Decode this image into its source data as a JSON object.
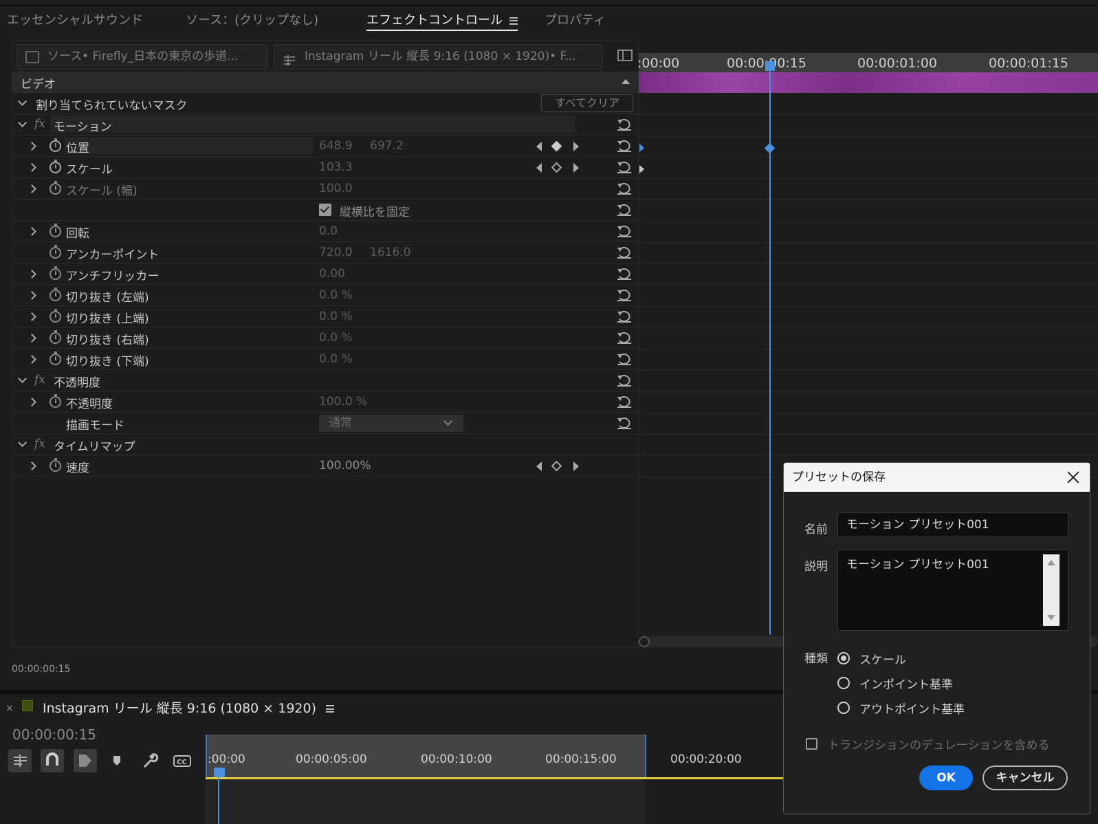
{
  "tabs": [
    {
      "label": "エッセンシャルサウンド",
      "active": false
    },
    {
      "label": "ソース：(クリップなし)",
      "active": false
    },
    {
      "label": "エフェクトコントロール",
      "active": true
    },
    {
      "label": "プロパティ",
      "active": false
    }
  ],
  "source_selector": {
    "source_label": "ソース• Firefly_日本の東京の歩道...",
    "sequence_label": "Instagram リール 縦長 9:16 (1080 × 1920)• F..."
  },
  "effect_controls": {
    "section_video": "ビデオ",
    "mask_label": "割り当てられていないマスク",
    "clear_all_button": "すべてクリア",
    "motion": {
      "title": "モーション",
      "position": {
        "label": "位置",
        "x": "648.9",
        "y": "697.2"
      },
      "scale": {
        "label": "スケール",
        "value": "103.3"
      },
      "scale_width": {
        "label": "スケール (幅)",
        "value": "100.0"
      },
      "uniform_scale": {
        "label": "縦横比を固定",
        "checked": true
      },
      "rotation": {
        "label": "回転",
        "value": "0.0"
      },
      "anchor": {
        "label": "アンカーポイント",
        "x": "720.0",
        "y": "1616.0"
      },
      "anti_flicker": {
        "label": "アンチフリッカー",
        "value": "0.00"
      },
      "crop_left": {
        "label": "切り抜き (左端)",
        "value": "0.0 %"
      },
      "crop_top": {
        "label": "切り抜き (上端)",
        "value": "0.0 %"
      },
      "crop_right": {
        "label": "切り抜き (右端)",
        "value": "0.0 %"
      },
      "crop_bottom": {
        "label": "切り抜き (下端)",
        "value": "0.0 %"
      }
    },
    "opacity": {
      "title": "不透明度",
      "opacity": {
        "label": "不透明度",
        "value": "100.0 %"
      },
      "blend_mode": {
        "label": "描画モード",
        "value": "通常"
      }
    },
    "time_remap": {
      "title": "タイムリマップ",
      "speed": {
        "label": "速度",
        "value": "100.00%"
      }
    },
    "timecode": "00:00:00:15"
  },
  "ec_ruler": {
    "ticks": [
      ":00:00",
      "00:00:00:15",
      "00:00:01:00",
      "00:00:01:15"
    ]
  },
  "sequence": {
    "title": "Instagram リール 縦長 9:16 (1080 × 1920)",
    "timecode": "00:00:00:15",
    "ruler": [
      ":00:00",
      "00:00:05:00",
      "00:00:10:00",
      "00:00:15:00",
      "00:00:20:00"
    ]
  },
  "dialog": {
    "title": "プリセットの保存",
    "name_label": "名前",
    "name_value": "モーション プリセット001",
    "desc_label": "説明",
    "desc_value": "モーション プリセット001",
    "type_label": "種類",
    "types": [
      {
        "label": "スケール",
        "selected": true
      },
      {
        "label": "インポイント基準",
        "selected": false
      },
      {
        "label": "アウトポイント基準",
        "selected": false
      }
    ],
    "include_transition_label": "トランジションのデュレーションを含める",
    "ok_label": "OK",
    "cancel_label": "キャンセル"
  },
  "colors": {
    "accent": "#1473e6",
    "playhead": "#4a8fe0",
    "clip": "#8a3597",
    "work_area": "#e6d23a"
  }
}
